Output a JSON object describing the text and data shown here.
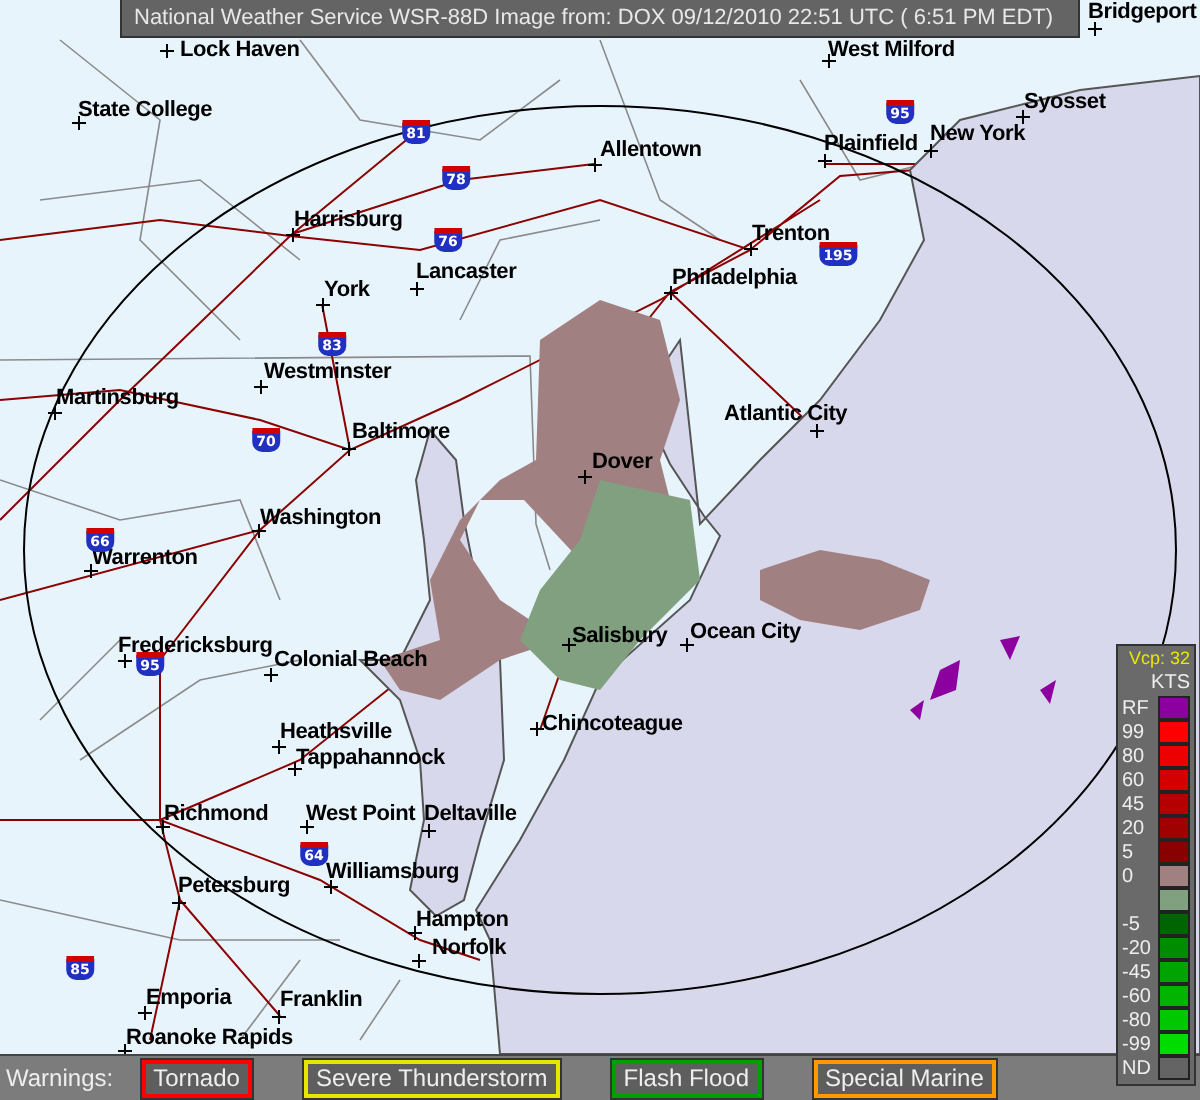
{
  "header": {
    "title": "National Weather Service WSR-88D Image from: DOX 09/12/2010 22:51 UTC ( 6:51 PM EDT)"
  },
  "map": {
    "cities": [
      {
        "name": "Lock Haven"
      },
      {
        "name": "West Milford"
      },
      {
        "name": "Bridgeport"
      },
      {
        "name": "State College"
      },
      {
        "name": "Syosset"
      },
      {
        "name": "Allentown"
      },
      {
        "name": "Plainfield"
      },
      {
        "name": "New York"
      },
      {
        "name": "Harrisburg"
      },
      {
        "name": "Trenton"
      },
      {
        "name": "Lancaster"
      },
      {
        "name": "Philadelphia"
      },
      {
        "name": "York"
      },
      {
        "name": "Westminster"
      },
      {
        "name": "Martinsburg"
      },
      {
        "name": "Atlantic City"
      },
      {
        "name": "Baltimore"
      },
      {
        "name": "Dover"
      },
      {
        "name": "Washington"
      },
      {
        "name": "Warrenton"
      },
      {
        "name": "Ocean City"
      },
      {
        "name": "Salisbury"
      },
      {
        "name": "Fredericksburg"
      },
      {
        "name": "Colonial Beach"
      },
      {
        "name": "Heathsville"
      },
      {
        "name": "Chincoteague"
      },
      {
        "name": "Tappahannock"
      },
      {
        "name": "Richmond"
      },
      {
        "name": "West Point"
      },
      {
        "name": "Deltaville"
      },
      {
        "name": "Williamsburg"
      },
      {
        "name": "Petersburg"
      },
      {
        "name": "Hampton"
      },
      {
        "name": "Norfolk"
      },
      {
        "name": "Emporia"
      },
      {
        "name": "Franklin"
      },
      {
        "name": "Roanoke Rapids"
      }
    ],
    "interstates": [
      {
        "number": "81"
      },
      {
        "number": "95"
      },
      {
        "number": "78"
      },
      {
        "number": "76"
      },
      {
        "number": "195"
      },
      {
        "number": "83"
      },
      {
        "number": "70"
      },
      {
        "number": "66"
      },
      {
        "number": "95"
      },
      {
        "number": "64"
      },
      {
        "number": "85"
      }
    ]
  },
  "legend": {
    "vcp": "Vcp: 32",
    "units": "KTS",
    "items": [
      {
        "label": "RF",
        "color": "#8c00a0"
      },
      {
        "label": "99",
        "color": "#ff0000"
      },
      {
        "label": "80",
        "color": "#ec0000"
      },
      {
        "label": "60",
        "color": "#d40000"
      },
      {
        "label": "45",
        "color": "#b40000"
      },
      {
        "label": "20",
        "color": "#a00000"
      },
      {
        "label": "5",
        "color": "#880000"
      },
      {
        "label": "0",
        "color": "#a08080"
      },
      {
        "color": "#80a080"
      },
      {
        "label": "-5",
        "color": "#006400"
      },
      {
        "label": "-20",
        "color": "#008c00"
      },
      {
        "label": "-45",
        "color": "#00a400"
      },
      {
        "label": "-60",
        "color": "#00b400"
      },
      {
        "label": "-80",
        "color": "#00c800"
      },
      {
        "label": "-99",
        "color": "#00dc00"
      },
      {
        "label": "ND",
        "color": "#646464"
      }
    ]
  },
  "warnings": {
    "label": "Warnings:",
    "items": [
      {
        "label": "Tornado",
        "color": "#ff0000"
      },
      {
        "label": "Severe Thunderstorm",
        "color": "#e6e600"
      },
      {
        "label": "Flash Flood",
        "color": "#00a000"
      },
      {
        "label": "Special Marine",
        "color": "#ff9900"
      }
    ]
  }
}
